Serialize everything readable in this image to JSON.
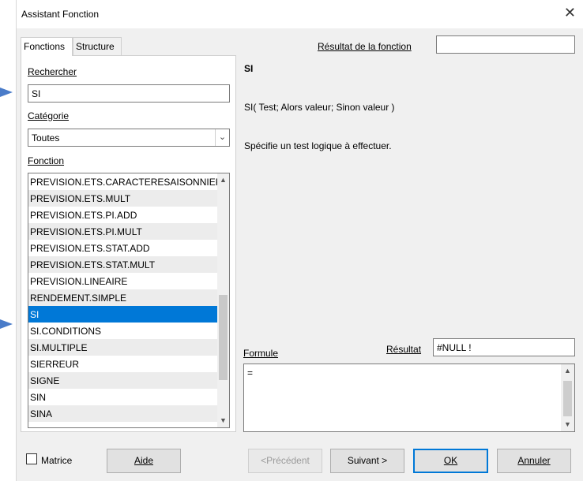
{
  "window": {
    "title": "Assistant Fonction",
    "close_glyph": "✕"
  },
  "tabs": [
    {
      "label": "Fonctions"
    },
    {
      "label": "Structure"
    }
  ],
  "left": {
    "search_label": "Rechercher",
    "search_value": "SI",
    "category_label": "Catégorie",
    "category_value": "Toutes",
    "function_label": "Fonction",
    "functions": [
      "PREVISION.ETS.CARACTERESAISONNIER",
      "PREVISION.ETS.MULT",
      "PREVISION.ETS.PI.ADD",
      "PREVISION.ETS.PI.MULT",
      "PREVISION.ETS.STAT.ADD",
      "PREVISION.ETS.STAT.MULT",
      "PREVISION.LINEAIRE",
      "RENDEMENT.SIMPLE",
      "SI",
      "SI.CONDITIONS",
      "SI.MULTIPLE",
      "SIERREUR",
      "SIGNE",
      "SIN",
      "SINA"
    ],
    "selected_function": "SI"
  },
  "right": {
    "result_label": "Résultat de la fonction",
    "result_value": "",
    "func_name": "SI",
    "func_syntax": "SI( Test; Alors valeur; Sinon valeur )",
    "func_desc": "Spécifie un test logique à effectuer.",
    "formula_label": "Formule",
    "formula_result_label": "Résultat",
    "formula_result_value": "#NULL !",
    "formula_value": "="
  },
  "footer": {
    "matrix_label": "Matrice",
    "help_label": "Aide",
    "prev_label": "<Précédent",
    "next_label": "Suivant >",
    "ok_label": "OK",
    "cancel_label": "Annuler"
  },
  "colors": {
    "annotation_arrow": "#4a7cc9",
    "selection": "#0078d7"
  }
}
